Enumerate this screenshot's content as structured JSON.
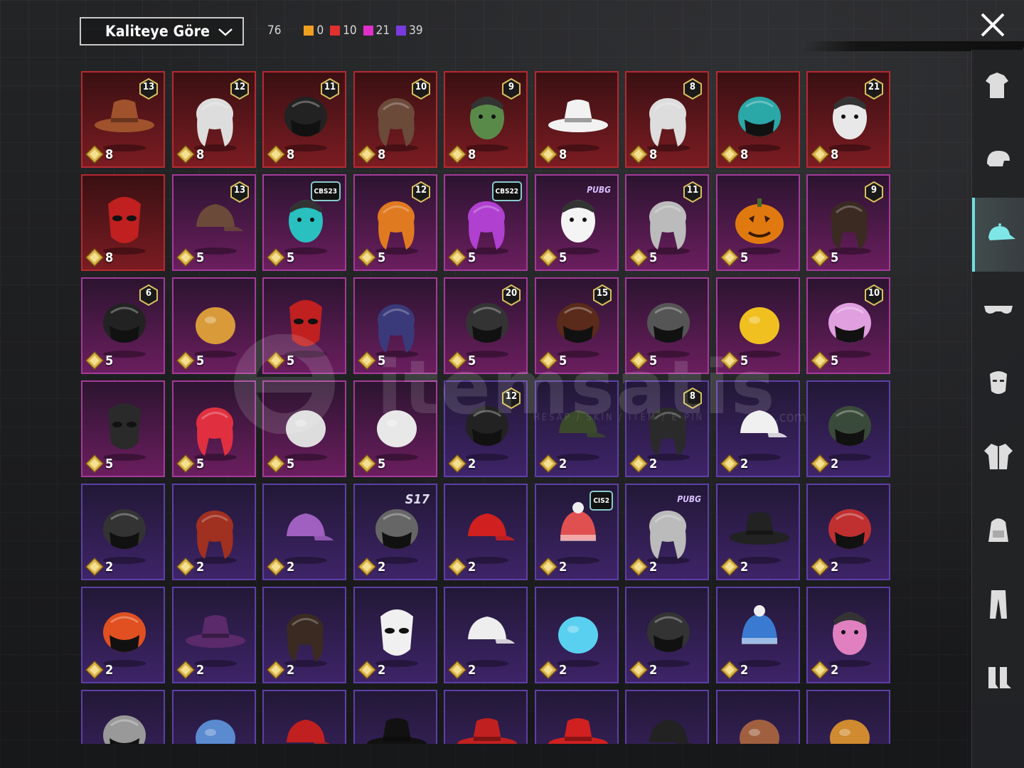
{
  "sort": {
    "label": "Kaliteye Göre"
  },
  "counts": {
    "total": "76",
    "groups": [
      {
        "color": "#f0a020",
        "value": "0"
      },
      {
        "color": "#e03030",
        "value": "10"
      },
      {
        "color": "#e030c8",
        "value": "21"
      },
      {
        "color": "#7a3ae0",
        "value": "39"
      }
    ]
  },
  "watermark": {
    "text": "itemsatis",
    "sub": "HESAP / SKIN / ITEM / E-PIN",
    "com": ".com"
  },
  "sidebar": {
    "items": [
      {
        "name": "outfit-category",
        "icon": "outfit-icon",
        "active": false
      },
      {
        "name": "hair-category",
        "icon": "hair-icon",
        "active": false
      },
      {
        "name": "hat-category",
        "icon": "cap-icon",
        "active": true
      },
      {
        "name": "eyewear-category",
        "icon": "glasses-icon",
        "active": false
      },
      {
        "name": "mask-category",
        "icon": "mask-icon",
        "active": false
      },
      {
        "name": "top-category",
        "icon": "jacket-icon",
        "active": false
      },
      {
        "name": "backpack-category",
        "icon": "backpack-icon",
        "active": false
      },
      {
        "name": "pants-category",
        "icon": "pants-icon",
        "active": false
      },
      {
        "name": "shoes-category",
        "icon": "boots-icon",
        "active": false
      }
    ]
  },
  "items": [
    {
      "q": "red",
      "price": "8",
      "badge": "13",
      "art": "hat-flower",
      "c": "#a0522d"
    },
    {
      "q": "red",
      "price": "8",
      "badge": "12",
      "art": "hair-white",
      "c": "#ddd"
    },
    {
      "q": "red",
      "price": "8",
      "badge": "11",
      "art": "helmet-dark",
      "c": "#222"
    },
    {
      "q": "red",
      "price": "8",
      "badge": "10",
      "art": "hair-brown",
      "c": "#6b4a3a"
    },
    {
      "q": "red",
      "price": "8",
      "badge": "9",
      "art": "head-green",
      "c": "#5a8a4a"
    },
    {
      "q": "red",
      "price": "8",
      "badge": "",
      "art": "hat-cowboy",
      "c": "#f2f2f2"
    },
    {
      "q": "red",
      "price": "8",
      "badge": "8",
      "art": "hair-white",
      "c": "#ddd"
    },
    {
      "q": "red",
      "price": "8",
      "badge": "",
      "art": "helmet-teal",
      "c": "#2aa7a7"
    },
    {
      "q": "red",
      "price": "8",
      "badge": "21",
      "art": "head-clown",
      "c": "#e8e8e8"
    },
    {
      "q": "red",
      "price": "8",
      "badge": "",
      "art": "mask-fox",
      "c": "#c02020"
    },
    {
      "q": "pink",
      "price": "5",
      "badge": "13",
      "art": "cap-aviator",
      "c": "#6b4a3a"
    },
    {
      "q": "pink",
      "price": "5",
      "season": "CBS23",
      "art": "headphone-cat",
      "c": "#2ac0c0"
    },
    {
      "q": "pink",
      "price": "5",
      "badge": "12",
      "art": "hair-orange",
      "c": "#e07a20"
    },
    {
      "q": "pink",
      "price": "5",
      "season": "CBS22",
      "art": "hair-purple",
      "c": "#b040d0"
    },
    {
      "q": "pink",
      "price": "5",
      "season": "PUBG",
      "art": "head-panda",
      "c": "#f4f4f4"
    },
    {
      "q": "pink",
      "price": "5",
      "badge": "11",
      "art": "hair-gray",
      "c": "#bbb"
    },
    {
      "q": "pink",
      "price": "5",
      "badge": "",
      "art": "pumpkin",
      "c": "#e07a10"
    },
    {
      "q": "pink",
      "price": "5",
      "badge": "9",
      "art": "hair-dark",
      "c": "#3a2a22"
    },
    {
      "q": "pink",
      "price": "5",
      "badge": "6",
      "art": "helmet-dark",
      "c": "#222"
    },
    {
      "q": "pink",
      "price": "5",
      "badge": "",
      "art": "potato",
      "c": "#d99a3a"
    },
    {
      "q": "pink",
      "price": "5",
      "badge": "",
      "art": "mask-red",
      "c": "#c02020"
    },
    {
      "q": "pink",
      "price": "5",
      "badge": "",
      "art": "hair-purple",
      "c": "#3a3a7a"
    },
    {
      "q": "pink",
      "price": "5",
      "badge": "20",
      "art": "helmet-dark",
      "c": "#333"
    },
    {
      "q": "pink",
      "price": "5",
      "badge": "15",
      "art": "helmet-spiky",
      "c": "#5a2a1a"
    },
    {
      "q": "pink",
      "price": "5",
      "badge": "",
      "art": "helmet-moto",
      "c": "#555"
    },
    {
      "q": "pink",
      "price": "5",
      "badge": "",
      "art": "duck",
      "c": "#f0c020"
    },
    {
      "q": "pink",
      "price": "5",
      "badge": "10",
      "art": "helmet-pink",
      "c": "#e0a0e0"
    },
    {
      "q": "pink",
      "price": "5",
      "badge": "",
      "art": "mask-black",
      "c": "#2a2a2a"
    },
    {
      "q": "pink",
      "price": "5",
      "badge": "",
      "art": "hair-red",
      "c": "#e03040"
    },
    {
      "q": "pink",
      "price": "5",
      "badge": "",
      "art": "goggles-pair",
      "c": "#ddd"
    },
    {
      "q": "pink",
      "price": "5",
      "badge": "",
      "art": "chicken",
      "c": "#e8e8e8"
    },
    {
      "q": "purple",
      "price": "2",
      "badge": "12",
      "art": "helmet-bunny",
      "c": "#222"
    },
    {
      "q": "purple",
      "price": "2",
      "badge": "",
      "art": "cap-military",
      "c": "#3a4a2a"
    },
    {
      "q": "purple",
      "price": "2",
      "badge": "8",
      "art": "hair-dark",
      "c": "#2a2a2a"
    },
    {
      "q": "purple",
      "price": "2",
      "badge": "",
      "art": "cap-baseball",
      "c": "#f0f0f0"
    },
    {
      "q": "purple",
      "price": "2",
      "badge": "",
      "art": "helmet-gas",
      "c": "#3a4a3a"
    },
    {
      "q": "purple",
      "price": "2",
      "badge": "",
      "art": "helmet-gold",
      "c": "#333"
    },
    {
      "q": "purple",
      "price": "2",
      "badge": "",
      "art": "hair-goggles",
      "c": "#a03020"
    },
    {
      "q": "purple",
      "price": "2",
      "badge": "",
      "art": "cap-colorful",
      "c": "#a060c0"
    },
    {
      "q": "purple",
      "price": "2",
      "season": "S17",
      "art": "helmet-horn",
      "c": "#666"
    },
    {
      "q": "purple",
      "price": "2",
      "badge": "",
      "art": "fez",
      "c": "#d02020"
    },
    {
      "q": "purple",
      "price": "2",
      "season": "CIS2",
      "art": "beanie-stripe",
      "c": "#e05050"
    },
    {
      "q": "purple",
      "price": "2",
      "season": "PUBG",
      "art": "hair-gray",
      "c": "#bbb"
    },
    {
      "q": "purple",
      "price": "2",
      "badge": "",
      "art": "hat-witch",
      "c": "#222"
    },
    {
      "q": "purple",
      "price": "2",
      "badge": "",
      "art": "helmet-football",
      "c": "#c03030"
    },
    {
      "q": "purple",
      "price": "2",
      "badge": "",
      "art": "helmet-hair",
      "c": "#e05020"
    },
    {
      "q": "purple",
      "price": "2",
      "badge": "",
      "art": "hat-top-purple",
      "c": "#5a2a6a"
    },
    {
      "q": "purple",
      "price": "2",
      "badge": "",
      "art": "hair-dark",
      "c": "#3a2a22"
    },
    {
      "q": "purple",
      "price": "2",
      "badge": "",
      "art": "mask-kabuki",
      "c": "#f0f0f0"
    },
    {
      "q": "purple",
      "price": "2",
      "badge": "",
      "art": "cap-white",
      "c": "#eee"
    },
    {
      "q": "purple",
      "price": "2",
      "badge": "",
      "art": "bunny-ears",
      "c": "#5ad0f0"
    },
    {
      "q": "purple",
      "price": "2",
      "badge": "",
      "art": "helmet-moto",
      "c": "#333"
    },
    {
      "q": "purple",
      "price": "2",
      "badge": "",
      "art": "beanie-blue",
      "c": "#3a7ad0"
    },
    {
      "q": "purple",
      "price": "2",
      "badge": "",
      "art": "headphone-cat",
      "c": "#e080c0"
    },
    {
      "q": "purple",
      "price": "",
      "badge": "",
      "art": "helmet-moto",
      "c": "#999"
    },
    {
      "q": "purple",
      "price": "",
      "badge": "",
      "art": "shark",
      "c": "#5a8ad0"
    },
    {
      "q": "purple",
      "price": "",
      "badge": "",
      "art": "beret",
      "c": "#c02020"
    },
    {
      "q": "purple",
      "price": "",
      "badge": "",
      "art": "hat-top",
      "c": "#111"
    },
    {
      "q": "purple",
      "price": "",
      "badge": "",
      "art": "hat-top",
      "c": "#c02020"
    },
    {
      "q": "purple",
      "price": "",
      "badge": "",
      "art": "bucket-hat",
      "c": "#d02020"
    },
    {
      "q": "purple",
      "price": "",
      "badge": "",
      "art": "cap-police",
      "c": "#222"
    },
    {
      "q": "purple",
      "price": "",
      "badge": "",
      "art": "icecream",
      "c": "#a06040"
    },
    {
      "q": "purple",
      "price": "",
      "badge": "",
      "art": "burger",
      "c": "#d08a30"
    }
  ]
}
